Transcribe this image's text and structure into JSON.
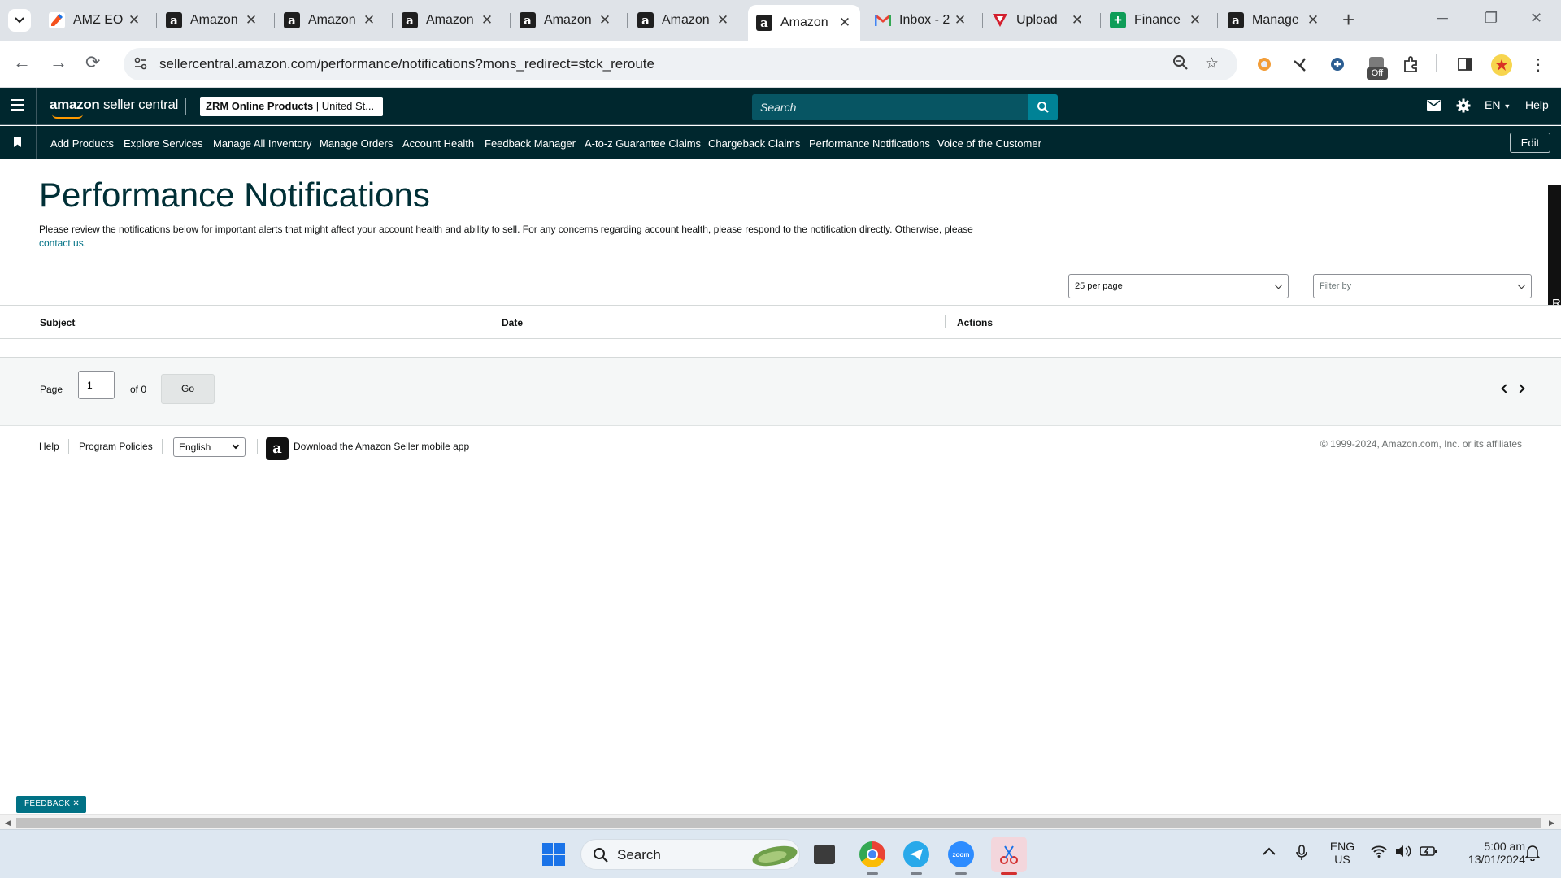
{
  "browser": {
    "tabs": [
      {
        "label": "AMZ EO",
        "icon": "edit-orange-icon"
      },
      {
        "label": "Amazon",
        "icon": "amazon-a-icon"
      },
      {
        "label": "Amazon",
        "icon": "amazon-a-icon"
      },
      {
        "label": "Amazon",
        "icon": "amazon-a-icon"
      },
      {
        "label": "Amazon",
        "icon": "amazon-a-icon"
      },
      {
        "label": "Amazon",
        "icon": "amazon-a-icon"
      },
      {
        "label": "Amazon",
        "icon": "amazon-a-icon",
        "active": true
      },
      {
        "label": "Inbox - 2",
        "icon": "gmail-icon"
      },
      {
        "label": "Upload",
        "icon": "upload-red-icon"
      },
      {
        "label": "Finance",
        "icon": "sheets-icon"
      },
      {
        "label": "Manage",
        "icon": "amazon-a-icon"
      }
    ],
    "url": "sellercentral.amazon.com/performance/notifications?mons_redirect=stck_reroute",
    "extension_badge": "Off"
  },
  "header": {
    "logo_brand": "amazon",
    "logo_product": "seller central",
    "store_name": "ZRM Online Products",
    "store_region": "United St...",
    "search_placeholder": "Search",
    "language": "EN",
    "help": "Help"
  },
  "nav": {
    "items": [
      "Add Products",
      "Explore Services",
      "Manage All Inventory",
      "Manage Orders",
      "Account Health",
      "Feedback Manager",
      "A-to-z Guarantee Claims",
      "Chargeback Claims",
      "Performance Notifications",
      "Voice of the Customer"
    ],
    "edit_label": "Edit"
  },
  "page": {
    "title": "Performance Notifications",
    "intro": "Please review the notifications below for important alerts that might affect your account health and ability to sell. For any concerns regarding account health, please respond to the notification directly. Otherwise, please",
    "contact_link": "contact us",
    "per_page": "25 per page",
    "filter_placeholder": "Filter by",
    "side_tab_letter": "R",
    "columns": [
      "Subject",
      "Date",
      "Actions"
    ],
    "pagination": {
      "page_label": "Page",
      "current": "1",
      "of_label": "of 0",
      "go_label": "Go"
    }
  },
  "footer": {
    "help": "Help",
    "program_policies": "Program Policies",
    "language": "English",
    "app_link": "Download the Amazon Seller mobile app",
    "copyright": "© 1999-2024, Amazon.com, Inc. or its affiliates"
  },
  "feedback_label": "FEEDBACK",
  "taskbar": {
    "search_label": "Search",
    "zoom_label": "zoom",
    "lang_line1": "ENG",
    "lang_line2": "US",
    "time": "5:00 am",
    "date": "13/01/2024"
  },
  "colors": {
    "header_bg": "#00272e",
    "search_btn": "#008296",
    "link": "#007185",
    "title": "#002f36"
  }
}
